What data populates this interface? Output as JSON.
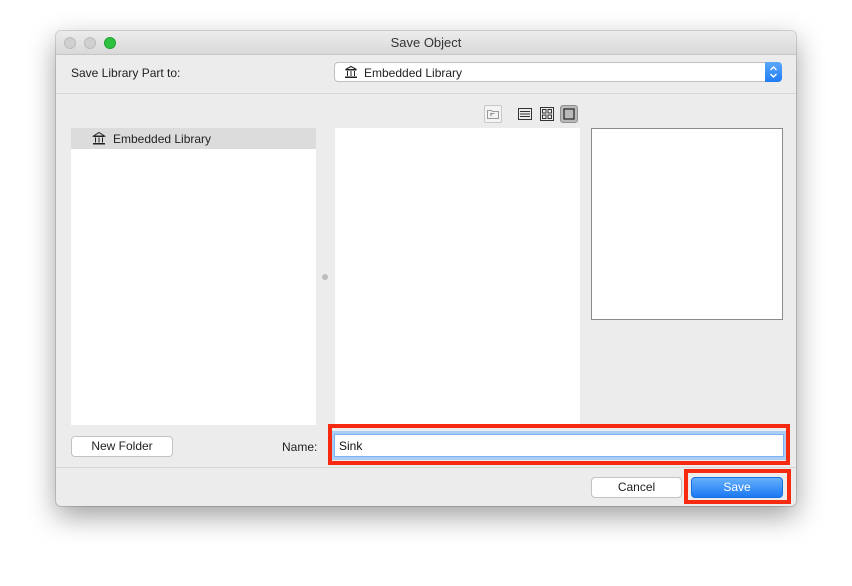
{
  "window": {
    "title": "Save Object"
  },
  "library": {
    "label": "Save Library Part to:",
    "selected": "Embedded Library"
  },
  "browser": {
    "items": [
      {
        "label": "Embedded Library",
        "icon": "library-icon"
      }
    ]
  },
  "view_tools": {
    "icons": [
      "folder-up-icon",
      "list-view-icon",
      "icon-view-icon",
      "preview-view-icon"
    ]
  },
  "form": {
    "new_folder_label": "New Folder",
    "name_label": "Name:",
    "name_value": "Sink"
  },
  "buttons": {
    "cancel_label": "Cancel",
    "save_label": "Save"
  },
  "colors": {
    "accent": "#1c79f5",
    "highlight": "#f52a11"
  }
}
